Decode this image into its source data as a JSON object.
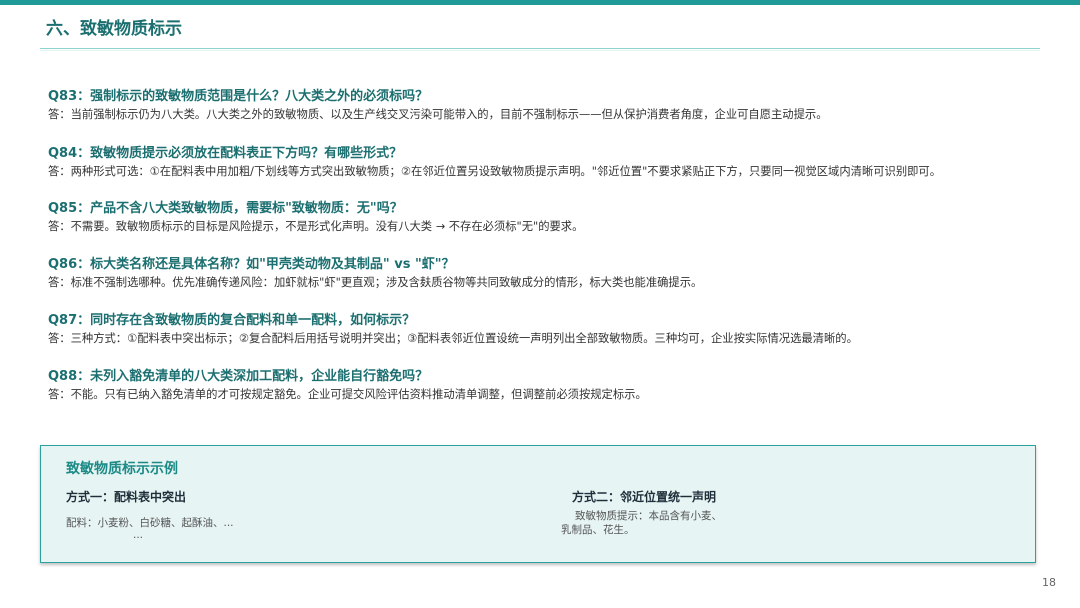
{
  "header": {
    "title": "六、致敏物质标示"
  },
  "faq": [
    {
      "question": "Q83：强制标示的致敏物质范围是什么？八大类之外的必须标吗？",
      "answer": "答：当前强制标示仍为八大类。八大类之外的致敏物质、以及生产线交叉污染可能带入的，目前不强制标示——但从保护消费者角度，企业可自愿主动提示。"
    },
    {
      "question": "Q84：致敏物质提示必须放在配料表正下方吗？有哪些形式？",
      "answer": "答：两种形式可选：①在配料表中用加粗/下划线等方式突出致敏物质；②在邻近位置另设致敏物质提示声明。\"邻近位置\"不要求紧贴正下方，只要同一视觉区域内清晰可识别即可。"
    },
    {
      "question": "Q85：产品不含八大类致敏物质，需要标\"致敏物质：无\"吗？",
      "answer": "答：不需要。致敏物质标示的目标是风险提示，不是形式化声明。没有八大类 → 不存在必须标\"无\"的要求。"
    },
    {
      "question": "Q86：标大类名称还是具体名称？如\"甲壳类动物及其制品\" vs \"虾\"？",
      "answer": "答：标准不强制选哪种。优先准确传递风险：加虾就标\"虾\"更直观；涉及含麸质谷物等共同致敏成分的情形，标大类也能准确提示。"
    },
    {
      "question": "Q87：同时存在含致敏物质的复合配料和单一配料，如何标示？",
      "answer": "答：三种方式：①配料表中突出标示；②复合配料后用括号说明并突出；③配料表邻近位置设统一声明列出全部致敏物质。三种均可，企业按实际情况选最清晰的。"
    },
    {
      "question": "Q88：未列入豁免清单的八大类深加工配料，企业能自行豁免吗？",
      "answer": "答：不能。只有已纳入豁免清单的才可按规定豁免。企业可提交风险评估资料推动清单调整，但调整前必须按规定标示。"
    }
  ],
  "example": {
    "title": "致敏物质标示示例",
    "method1": {
      "label": "方式一：配料表中突出",
      "line1": "配料：小麦粉、白砂糖、起酥油、...",
      "line2": "..."
    },
    "method2": {
      "label": "方式二：邻近位置统一声明",
      "line1": "致敏物质提示：本品含有小麦、",
      "line2": "乳制品、花生。"
    }
  },
  "footer": {
    "page_number": "18"
  },
  "colors": {
    "accent": "#1f9a96",
    "heading": "#1c6f70",
    "box_background": "#e6f4f3"
  }
}
